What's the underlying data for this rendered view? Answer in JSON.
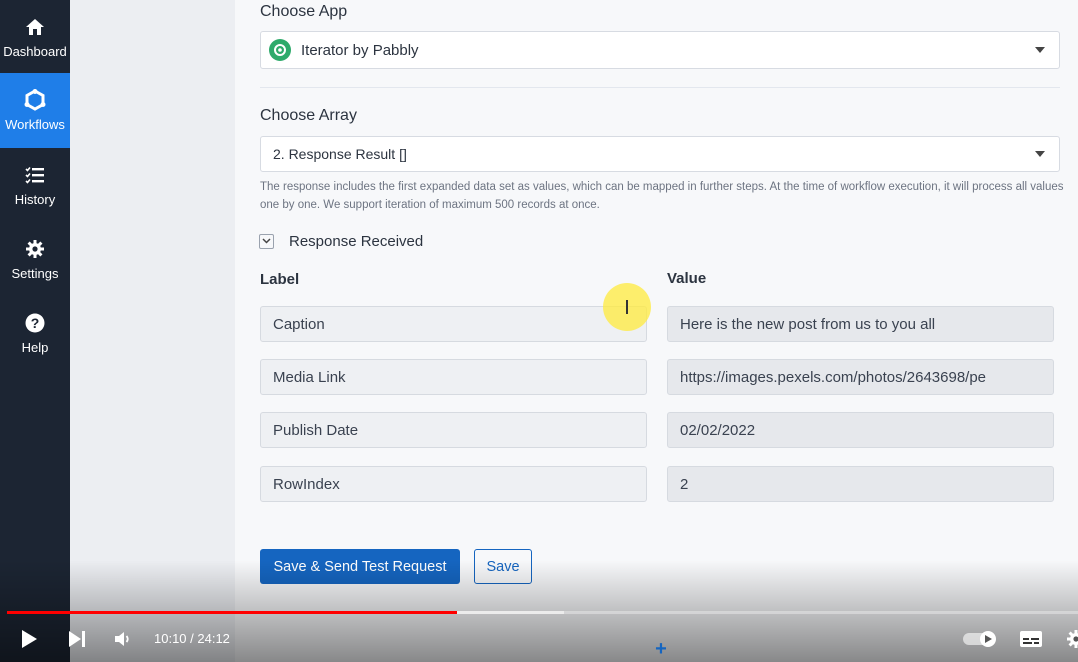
{
  "sidebar": {
    "items": [
      {
        "label": "Dashboard",
        "icon": "home-icon",
        "active": false
      },
      {
        "label": "Workflows",
        "icon": "workflows-icon",
        "active": true
      },
      {
        "label": "History",
        "icon": "history-icon",
        "active": false
      },
      {
        "label": "Settings",
        "icon": "gear-icon",
        "active": false
      },
      {
        "label": "Help",
        "icon": "help-icon",
        "active": false
      }
    ]
  },
  "form": {
    "choose_app_label": "Choose App",
    "app_value": "Iterator by Pabbly",
    "choose_array_label": "Choose Array",
    "array_value": "2. Response Result []",
    "help_text": "The response includes the first expanded data set as values, which can be mapped in further steps. At the time of workflow execution, it will process all values one by one. We support iteration of maximum 500 records at once.",
    "response_received_label": "Response Received",
    "label_header": "Label",
    "value_header": "Value",
    "rows": [
      {
        "label": "Caption",
        "value": "Here is the new post from us to you all"
      },
      {
        "label": "Media Link",
        "value": "https://images.pexels.com/photos/2643698/pe"
      },
      {
        "label": "Publish Date",
        "value": "02/02/2022"
      },
      {
        "label": "RowIndex",
        "value": "2"
      }
    ],
    "save_test_label": "Save & Send Test Request",
    "save_label": "Save"
  },
  "player": {
    "current_time": "10:10",
    "duration": "24:12",
    "time_display": "10:10 / 24:12",
    "played_fraction": 0.42,
    "buffered_fraction": 0.52
  },
  "colors": {
    "sidebar_bg": "#1c2533",
    "active_nav": "#1f7ee8",
    "primary": "#1565c0",
    "progress": "#ff0000"
  }
}
